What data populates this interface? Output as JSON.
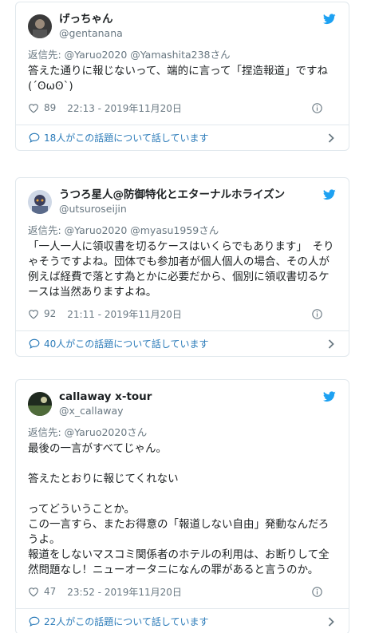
{
  "tweets": [
    {
      "display_name": "げっちゃん",
      "handle": "@gentanana",
      "reply_to": "返信先: @Yaruo2020 @Yamashita238さん",
      "text": "答えた通りに報じないって、端的に言って「捏造報道」ですね(´ʘωʘ`)",
      "likes": "89",
      "timestamp": "22:13 - 2019年11月20日",
      "conversation": "18人がこの話題について話しています"
    },
    {
      "display_name": "うつろ星人@防御特化とエターナルホライズン",
      "handle": "@utsuroseijin",
      "reply_to": "返信先: @Yaruo2020 @myasu1959さん",
      "text": "「一人一人に領収書を切るケースはいくらでもあります」　そりゃそうですよね。団体でも参加者が個人個人の場合、その人が例えば経費で落とす為とかに必要だから、個別に領収書切るケースは当然ありますよね。",
      "likes": "92",
      "timestamp": "21:11 - 2019年11月20日",
      "conversation": "40人がこの話題について話しています"
    },
    {
      "display_name": "callaway x-tour",
      "handle": "@x_callaway",
      "reply_to": "返信先: @Yaruo2020さん",
      "text": "最後の一言がすべてじゃん。\n\n答えたとおりに報じてくれない\n\nってどういうことか。\nこの一言すら、またお得意の「報道しない自由」発動なんだろうよ。\n報道をしないマスコミ関係者のホテルの利用は、お断りして全然問題なし！ニューオータニになんの罪があると言うのか。",
      "likes": "47",
      "timestamp": "23:52 - 2019年11月20日",
      "conversation": "22人がこの話題について話しています"
    }
  ],
  "colors": {
    "accent": "#1da1f2",
    "link": "#2b7bb9",
    "muted": "#697882",
    "border": "#e1e8ed"
  }
}
